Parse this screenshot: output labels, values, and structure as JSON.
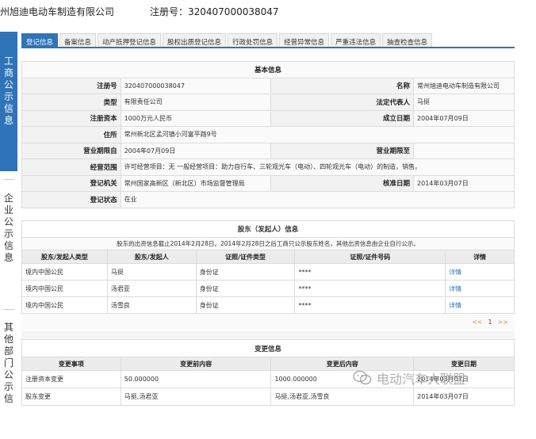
{
  "header": {
    "company_name": "州旭迪电动车制造有限公司",
    "registration": "注册号：320407000038047"
  },
  "sidenav": {
    "items": [
      {
        "label": "工商公示信息",
        "chars": [
          "工",
          "商",
          "公",
          "示",
          "信",
          "息"
        ]
      },
      {
        "label": "企业公示信息",
        "chars": [
          "企",
          "业",
          "公",
          "示",
          "信",
          "息"
        ]
      },
      {
        "label": "其他部门公示信",
        "chars": [
          "其",
          "他",
          "部",
          "门",
          "公",
          "示",
          "信"
        ]
      }
    ]
  },
  "tabs": [
    {
      "label": "登记信息",
      "active": true
    },
    {
      "label": "备案信息"
    },
    {
      "label": "动产抵押登记信息"
    },
    {
      "label": "股权出质登记信息"
    },
    {
      "label": "行政处罚信息"
    },
    {
      "label": "经营异常信息"
    },
    {
      "label": "严重违法信息"
    },
    {
      "label": "抽查检查信息"
    }
  ],
  "basic": {
    "title": "基本信息",
    "reg_no_label": "注册号",
    "reg_no": "320407000038047",
    "name_label": "名称",
    "name": "常州旭迪电动车制造有限公司",
    "type_label": "类型",
    "type": "有限责任公司",
    "legal_rep_label": "法定代表人",
    "legal_rep": "马挺",
    "capital_label": "注册资本",
    "capital": "1000万元人民币",
    "established_label": "成立日期",
    "established": "2004年07月09日",
    "address_label": "住所",
    "address": "常州新北区孟河镇小河富平路9号",
    "term_from_label": "营业期限自",
    "term_from": "2004年07月09日",
    "term_to_label": "营业期限至",
    "term_to": "",
    "scope_label": "经营范围",
    "scope": "许可经营项目：无 一般经营项目：助力自行车、三轮观光车（电动）、四轮观光车（电动）的制造，销售。",
    "authority_label": "登记机关",
    "authority": "常州国家高新区（新北区）市场监督管理局",
    "approval_label": "核准日期",
    "approval": "2014年03月07日",
    "status_label": "登记状态",
    "status": "在业"
  },
  "shareholders": {
    "title": "股东（发起人）信息",
    "note": "股东的出资信息截止2014年2月28日。2014年2月28日之后工商只公示股东姓名，其他出资信息由企业自行公示。",
    "columns": [
      "股东/发起人类型",
      "股东/发起人",
      "证照/证件类型",
      "证照/证件号码",
      "详情"
    ],
    "rows": [
      {
        "type": "境内中国公民",
        "name": "马挺",
        "id_type": "身份证",
        "id_no": "****",
        "detail": "详情"
      },
      {
        "type": "境内中国公民",
        "name": "汤君亚",
        "id_type": "身份证",
        "id_no": "****",
        "detail": "详情"
      },
      {
        "type": "境内中国公民",
        "name": "汤雪良",
        "id_type": "身份证",
        "id_no": "****",
        "detail": "详情"
      }
    ],
    "pager": {
      "prev": "<<",
      "current": "1",
      "next": ">>"
    }
  },
  "changes": {
    "title": "变更信息",
    "columns": [
      "变更事项",
      "变更前内容",
      "变更后内容",
      "变更日期"
    ],
    "rows": [
      {
        "item": "注册资本变更",
        "before": "50.000000",
        "after": "1000.000000",
        "date": "2014年03月07日"
      },
      {
        "item": "股东变更",
        "before": "马挺,汤君亚",
        "after": "马挺,汤君亚,汤雪良",
        "date": "2014年03月07日"
      }
    ]
  },
  "watermark": {
    "text": "电动汽车大联盟",
    "icon": "wechat-icon"
  }
}
